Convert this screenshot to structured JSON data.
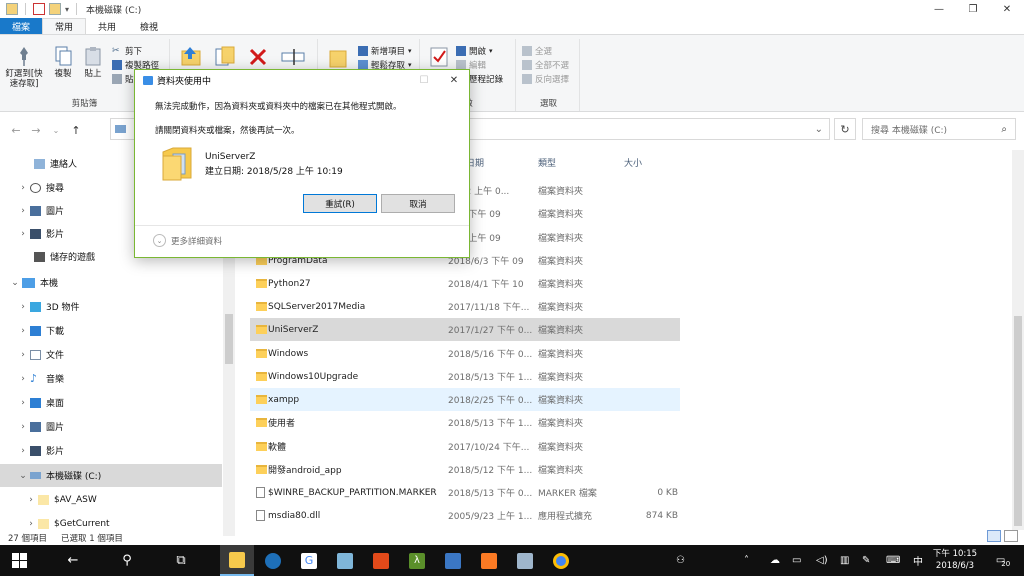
{
  "window": {
    "title": "本機磁碟 (C:)",
    "controls": {
      "minimize": "—",
      "maximize": "❐",
      "close": "✕"
    }
  },
  "ribbon_tabs": [
    "檔案",
    "常用",
    "共用",
    "檢視"
  ],
  "ribbon": {
    "clipboard": {
      "pin_label": "釘選到[快速存取]",
      "copy_label": "複製",
      "paste_label": "貼上",
      "cut_label": "剪下",
      "copy_path_label": "複製路徑",
      "paste_shortcut_label": "貼",
      "group_label": "剪貼簿"
    },
    "new": {
      "new_item_label": "新增項目",
      "easy_access_label": "輕鬆存取"
    },
    "open": {
      "open_label": "開啟",
      "edit_label": "編輯",
      "history_label": "歷程記錄",
      "group_label": "啟"
    },
    "select": {
      "select_all_label": "全選",
      "select_none_label": "全部不選",
      "invert_label": "反向選擇",
      "group_label": "選取"
    }
  },
  "navigation": {
    "search_placeholder": "搜尋 本機磁碟 (C:)"
  },
  "columns": {
    "date": "日期",
    "type": "類型",
    "size": "大小"
  },
  "nav_pane": [
    {
      "label": "連絡人",
      "expand": ""
    },
    {
      "label": "搜尋",
      "expand": "›"
    },
    {
      "label": "圖片",
      "expand": "›"
    },
    {
      "label": "影片",
      "expand": "›"
    },
    {
      "label": "儲存的遊戲",
      "expand": ""
    },
    {
      "label": "本機",
      "expand": "⌄"
    },
    {
      "label": "3D 物件",
      "expand": "›"
    },
    {
      "label": "下載",
      "expand": "›"
    },
    {
      "label": "文件",
      "expand": "›"
    },
    {
      "label": "音樂",
      "expand": "›"
    },
    {
      "label": "桌面",
      "expand": "›"
    },
    {
      "label": "圖片",
      "expand": "›"
    },
    {
      "label": "影片",
      "expand": "›"
    },
    {
      "label": "本機磁碟 (C:)",
      "expand": "⌄"
    },
    {
      "label": "$AV_ASW",
      "expand": "›"
    },
    {
      "label": "$GetCurrent",
      "expand": "›"
    }
  ],
  "files": [
    {
      "name": "",
      "date": "/4/12 上午 0...",
      "type": "檔案資料夾",
      "size": ""
    },
    {
      "name": "",
      "date": "/6/3 下午 09",
      "type": "檔案資料夾",
      "size": ""
    },
    {
      "name": "",
      "date": "/6/1 上午 09",
      "type": "檔案資料夾",
      "size": ""
    },
    {
      "name": "ProgramData",
      "date": "2018/6/3 下午 09",
      "type": "檔案資料夾",
      "size": ""
    },
    {
      "name": "Python27",
      "date": "2018/4/1 下午 10",
      "type": "檔案資料夾",
      "size": ""
    },
    {
      "name": "SQLServer2017Media",
      "date": "2017/11/18 下午...",
      "type": "檔案資料夾",
      "size": ""
    },
    {
      "name": "UniServerZ",
      "date": "2017/1/27 下午 0...",
      "type": "檔案資料夾",
      "size": ""
    },
    {
      "name": "Windows",
      "date": "2018/5/16 下午 0...",
      "type": "檔案資料夾",
      "size": ""
    },
    {
      "name": "Windows10Upgrade",
      "date": "2018/5/13 下午 1...",
      "type": "檔案資料夾",
      "size": ""
    },
    {
      "name": "xampp",
      "date": "2018/2/25 下午 0...",
      "type": "檔案資料夾",
      "size": ""
    },
    {
      "name": "使用者",
      "date": "2018/5/13 下午 1...",
      "type": "檔案資料夾",
      "size": ""
    },
    {
      "name": "軟體",
      "date": "2017/10/24 下午...",
      "type": "檔案資料夾",
      "size": ""
    },
    {
      "name": "開發android_app",
      "date": "2018/5/12 下午 1...",
      "type": "檔案資料夾",
      "size": ""
    },
    {
      "name": "$WINRE_BACKUP_PARTITION.MARKER",
      "date": "2018/5/13 下午 0...",
      "type": "MARKER 檔案",
      "size": "0 KB"
    },
    {
      "name": "msdia80.dll",
      "date": "2005/9/23 上午 1...",
      "type": "應用程式擴充",
      "size": "874 KB"
    }
  ],
  "status": {
    "count": "27 個項目",
    "selected": "已選取 1 個項目"
  },
  "dialog": {
    "title": "資料夾使用中",
    "message": "無法完成動作，因為資料夾或資料夾中的檔案已在其他程式開啟。",
    "instruction": "請關閉資料夾或檔案，然後再試一次。",
    "item_name": "UniServerZ",
    "item_date": "建立日期: 2018/5/28 上午 10:19",
    "retry_label": "重試(R)",
    "cancel_label": "取消",
    "more_details_label": "更多詳細資料"
  },
  "taskbar": {
    "clock_time": "下午 10:15",
    "clock_date": "2018/6/3",
    "ime": "中",
    "notification_count": "20"
  }
}
